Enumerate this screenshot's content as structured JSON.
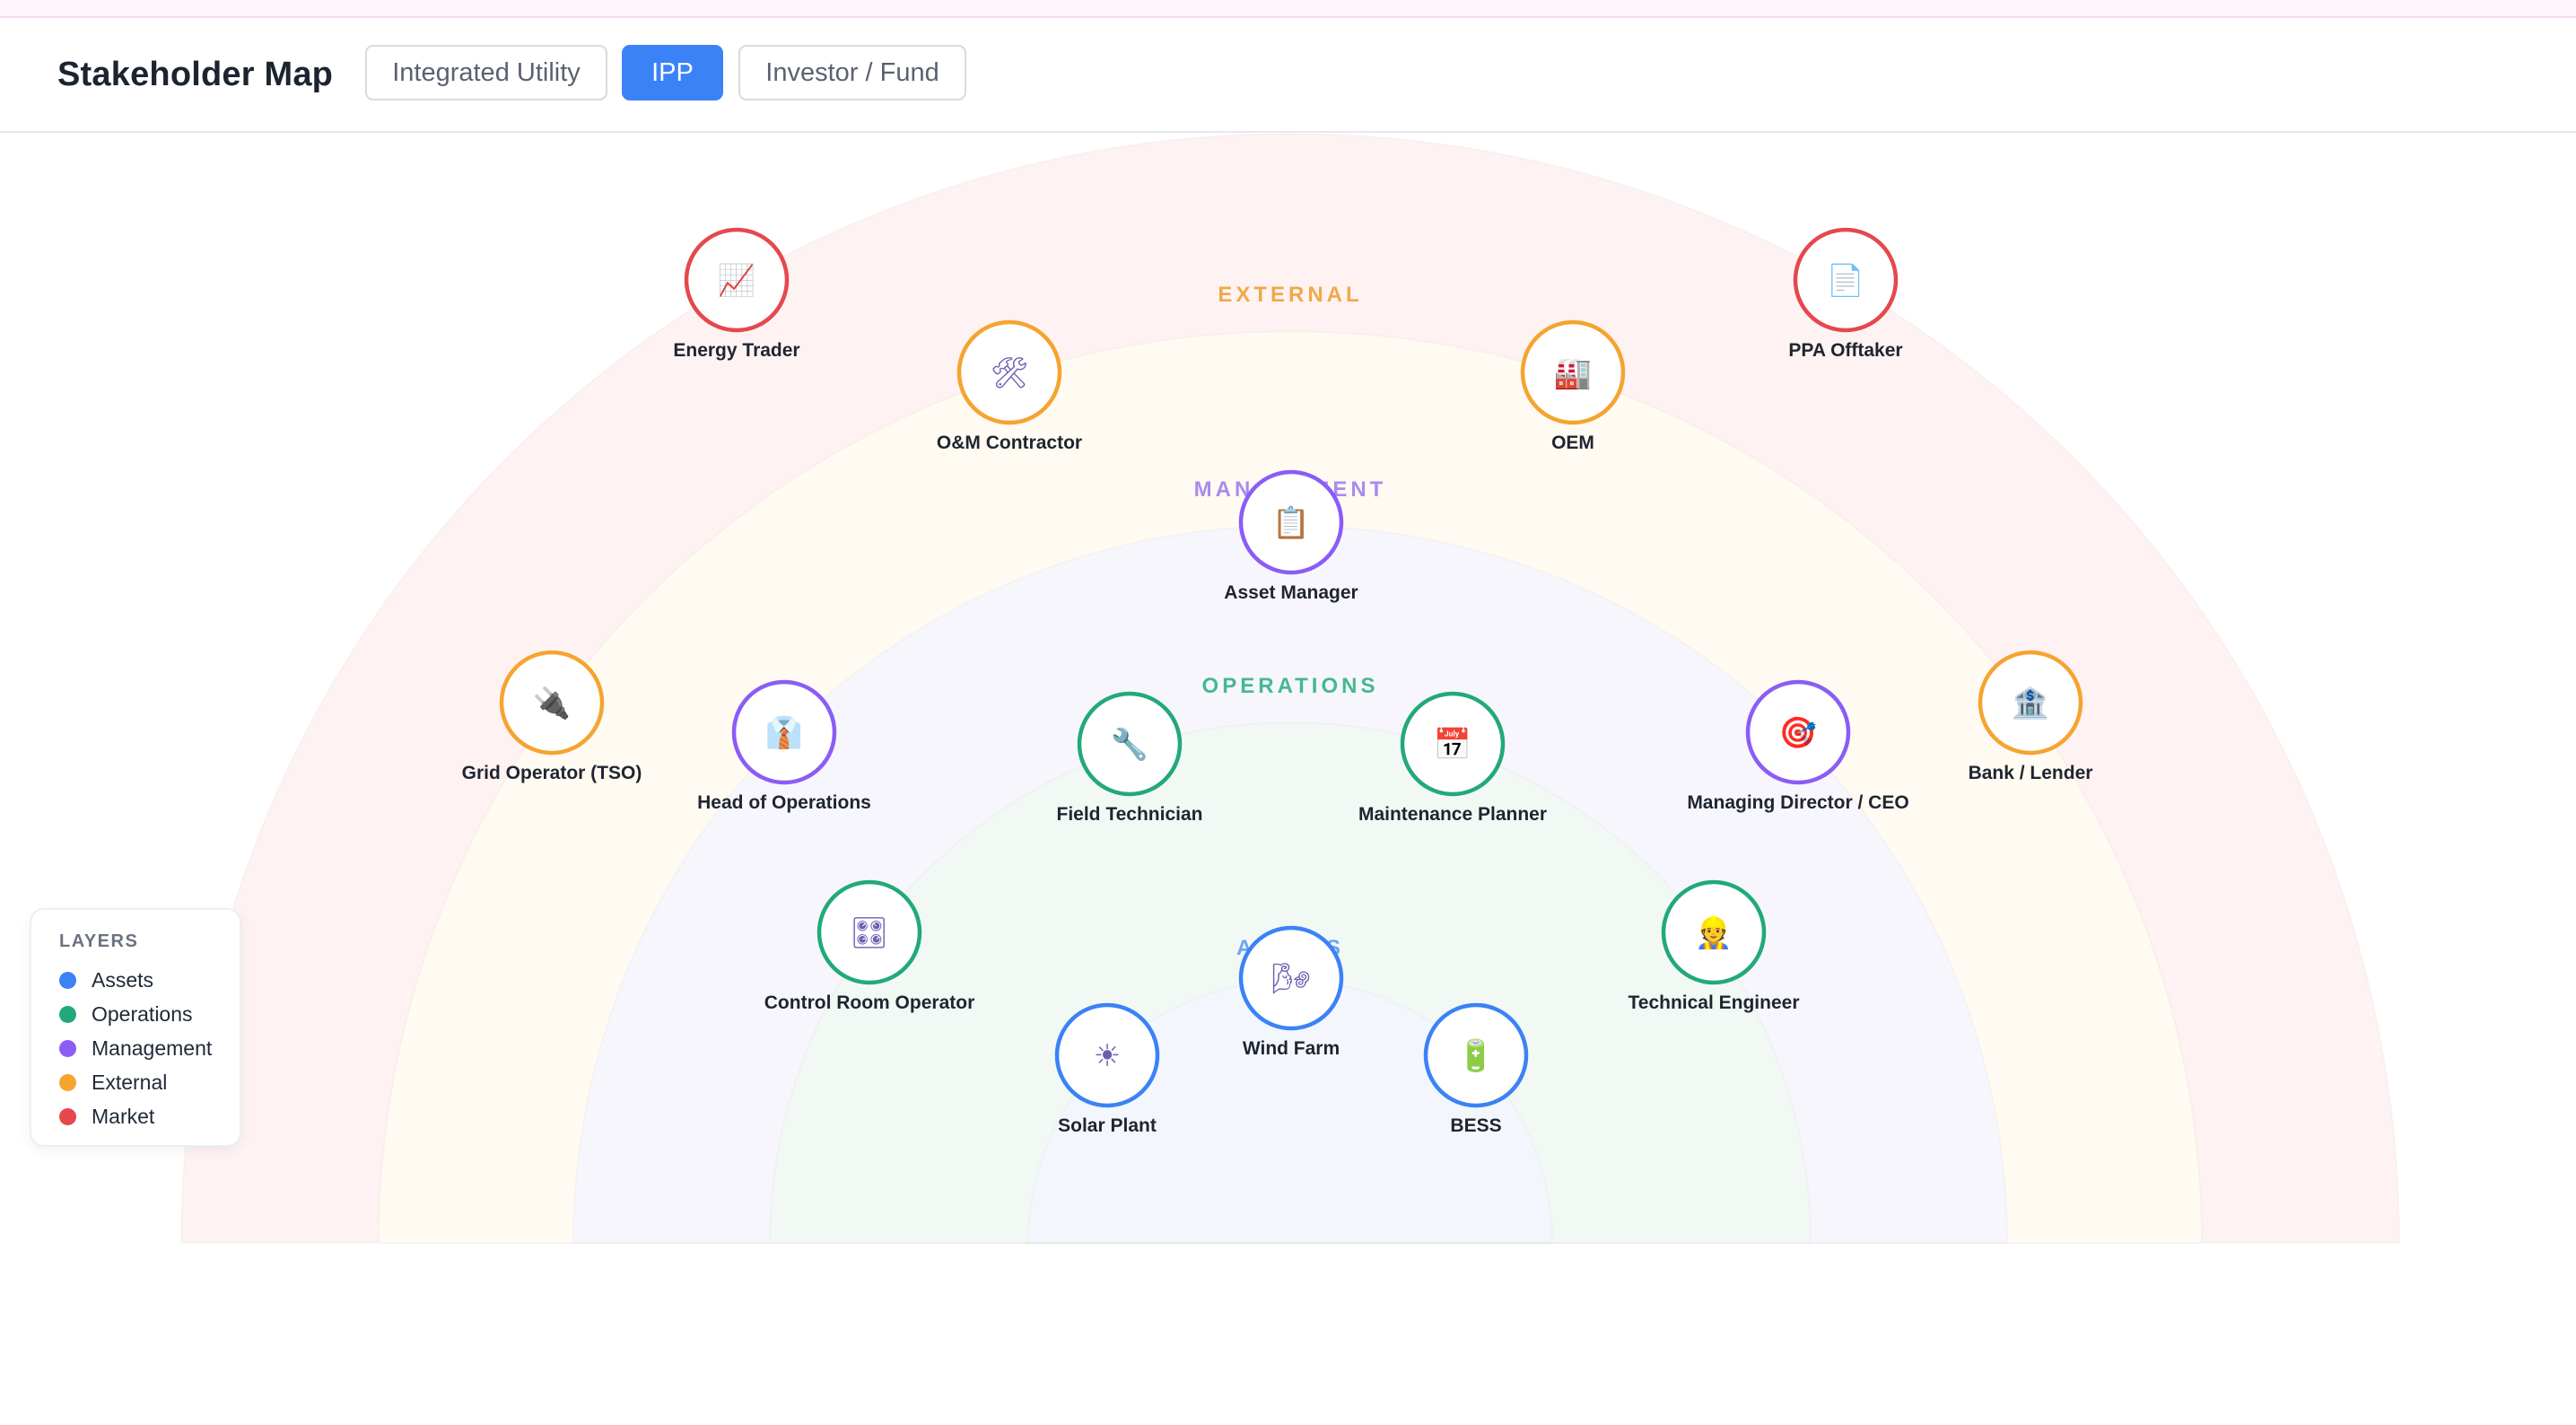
{
  "header": {
    "title": "Stakeholder Map",
    "tabs": [
      {
        "label": "Integrated Utility",
        "active": false
      },
      {
        "label": "IPP",
        "active": true
      },
      {
        "label": "Investor / Fund",
        "active": false
      }
    ]
  },
  "layers": [
    {
      "key": "assets",
      "label": "Assets",
      "color": "#3b82f6"
    },
    {
      "key": "operations",
      "label": "Operations",
      "color": "#22a97a"
    },
    {
      "key": "management",
      "label": "Management",
      "color": "#8b5cf6"
    },
    {
      "key": "external",
      "label": "External",
      "color": "#f5a430"
    },
    {
      "key": "market",
      "label": "Market",
      "color": "#e5484d"
    }
  ],
  "ring_labels": [
    {
      "layer": "external",
      "text": "EXTERNAL",
      "color": "#f0a94a"
    },
    {
      "layer": "management",
      "text": "MANAGEMENT",
      "color": "#a98bf0"
    },
    {
      "layer": "operations",
      "text": "OPERATIONS",
      "color": "#45b98e"
    },
    {
      "layer": "assets",
      "text": "ASSETS",
      "color": "#6aa5f5"
    }
  ],
  "nodes": [
    {
      "label": "Energy Trader",
      "layer": "market",
      "icon": "chart-increasing-icon",
      "glyph": "📈"
    },
    {
      "label": "PPA Offtaker",
      "layer": "market",
      "icon": "document-icon",
      "glyph": "📄"
    },
    {
      "label": "O&M Contractor",
      "layer": "external",
      "icon": "hammer-and-wrench-icon",
      "glyph": "🛠"
    },
    {
      "label": "OEM",
      "layer": "external",
      "icon": "factory-icon",
      "glyph": "🏭"
    },
    {
      "label": "Grid Operator (TSO)",
      "layer": "external",
      "icon": "plug-icon",
      "glyph": "🔌"
    },
    {
      "label": "Bank / Lender",
      "layer": "external",
      "icon": "bank-icon",
      "glyph": "🏦"
    },
    {
      "label": "Asset Manager",
      "layer": "management",
      "icon": "clipboard-icon",
      "glyph": "📋"
    },
    {
      "label": "Head of Operations",
      "layer": "management",
      "icon": "person-in-suit-icon",
      "glyph": "👔"
    },
    {
      "label": "Managing Director / CEO",
      "layer": "management",
      "icon": "target-icon",
      "glyph": "🎯"
    },
    {
      "label": "Field Technician",
      "layer": "operations",
      "icon": "wrench-icon",
      "glyph": "🔧"
    },
    {
      "label": "Maintenance Planner",
      "layer": "operations",
      "icon": "calendar-icon",
      "glyph": "📅"
    },
    {
      "label": "Control Room Operator",
      "layer": "operations",
      "icon": "control-knobs-icon",
      "glyph": "🎛"
    },
    {
      "label": "Technical Engineer",
      "layer": "operations",
      "icon": "engineer-icon",
      "glyph": "👷"
    },
    {
      "label": "Wind Farm",
      "layer": "assets",
      "icon": "wind-turbine-icon",
      "glyph": "🌬"
    },
    {
      "label": "Solar Plant",
      "layer": "assets",
      "icon": "sun-icon",
      "glyph": "☀"
    },
    {
      "label": "BESS",
      "layer": "assets",
      "icon": "battery-icon",
      "glyph": "🔋"
    }
  ],
  "legend": {
    "title": "LAYERS"
  }
}
